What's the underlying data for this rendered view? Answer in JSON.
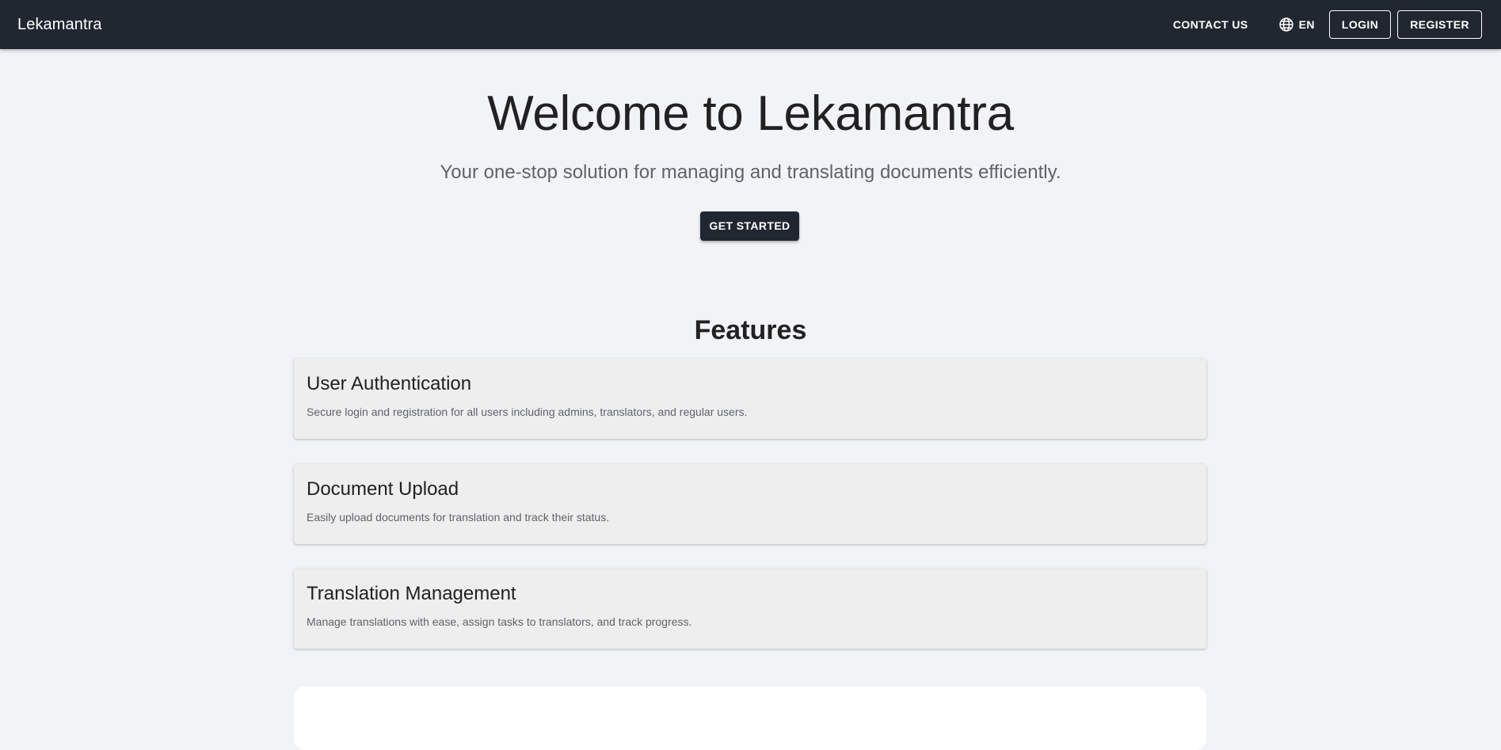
{
  "app": {
    "brand": "Lekamantra"
  },
  "nav": {
    "contact_label": "CONTACT US",
    "language_label": "EN",
    "language_icon": "globe-icon",
    "login_label": "LOGIN",
    "register_label": "REGISTER"
  },
  "hero": {
    "title": "Welcome to Lekamantra",
    "subtitle": "Your one-stop solution for managing and translating documents efficiently.",
    "cta_label": "GET STARTED"
  },
  "features": {
    "heading": "Features",
    "items": [
      {
        "title": "User Authentication",
        "description": "Secure login and registration for all users including admins, translators, and regular users."
      },
      {
        "title": "Document Upload",
        "description": "Easily upload documents for translation and track their status."
      },
      {
        "title": "Translation Management",
        "description": "Manage translations with ease, assign tasks to translators, and track progress."
      }
    ]
  },
  "colors": {
    "appbar_bg": "#202731",
    "page_bg": "#f2f3f6",
    "card_bg": "#eeeeee",
    "primary_button": "#202731"
  }
}
